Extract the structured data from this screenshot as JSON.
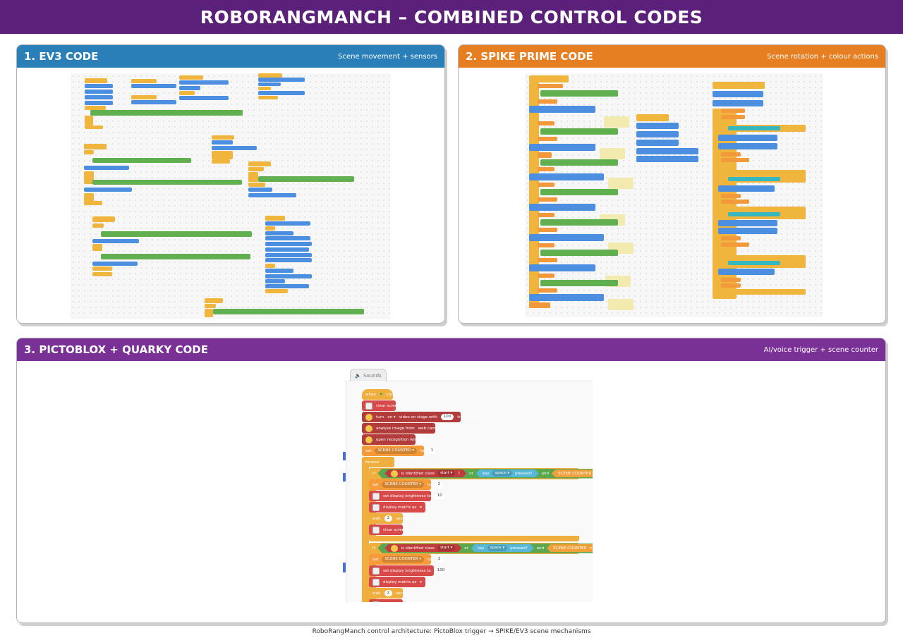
{
  "header": {
    "title": "ROBORANGMANCH – COMBINED CONTROL CODES"
  },
  "panels": {
    "ev3": {
      "title": "1. EV3 CODE",
      "subtitle": "Scene movement + sensors",
      "color": "#2b7fb9"
    },
    "spike": {
      "title": "2. SPIKE PRIME CODE",
      "subtitle": "Scene rotation + colour actions",
      "color": "#e67e22"
    },
    "pictoblox": {
      "title": "3. PICTOBLOX + QUARKY CODE",
      "subtitle": "AI/voice trigger + scene counter",
      "color": "#7a3195"
    }
  },
  "pictoblox": {
    "tab_label": "Sounds",
    "when_flag": "when",
    "clicked": "clicked",
    "clear_screen": "clear screen",
    "turn": "turn",
    "on": "on",
    "video_on_stage": "video on stage with",
    "transparency_value": "100",
    "transparency": "transparency",
    "analyse_image": "analyse image from",
    "web_camera": "web camera",
    "open_recognition": "open recognition window",
    "set": "set",
    "scene_counter": "SCENE COUNTER",
    "to": "to",
    "init_value": "1",
    "forever": "forever",
    "if": "if",
    "is_identified_class": "is identified class",
    "start": "start",
    "q": "?",
    "or": "or",
    "key": "key",
    "space": "space",
    "pressed": "pressed?",
    "and": "and",
    "eq": "=",
    "then": "then",
    "cond1_value": "1",
    "set1_value": "2",
    "set_display_brightness": "set display brightness to",
    "brightness1": "10",
    "display_matrix": "display matrix as",
    "wait": "wait",
    "wait_value": "2",
    "seconds": "seconds",
    "cond2_value": "2",
    "set2_value": "3",
    "brightness2": "100"
  },
  "footer": {
    "caption": "RoboRangManch control architecture: PictoBlox trigger → SPIKE/EV3 scene mechanisms"
  }
}
